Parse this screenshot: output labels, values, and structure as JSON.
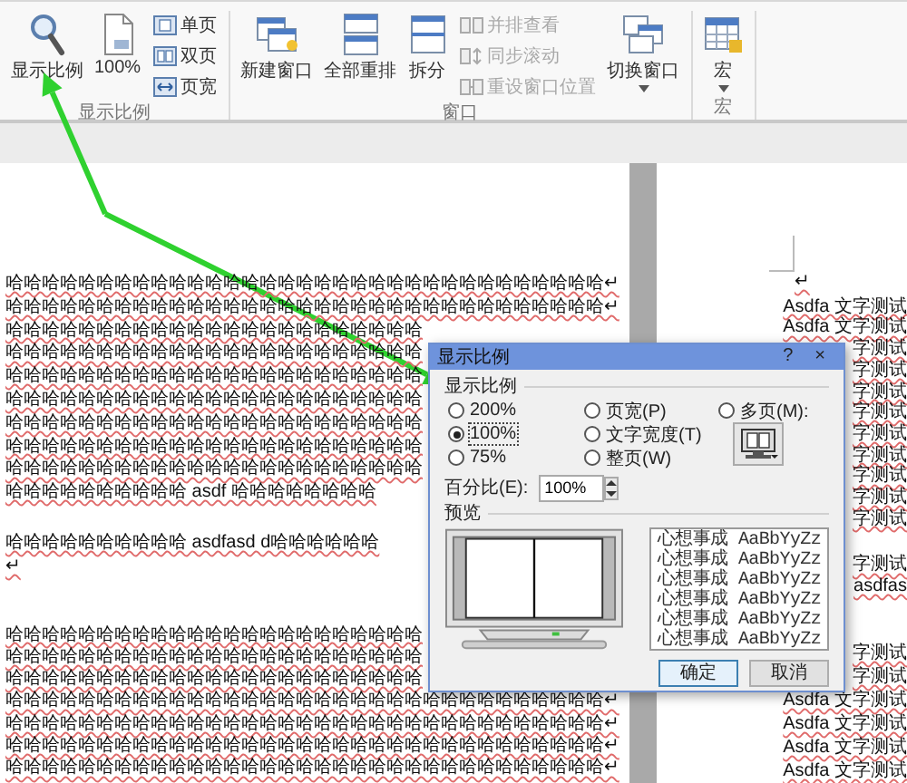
{
  "ribbon": {
    "groups": [
      {
        "label": "显示比例",
        "items": [
          {
            "kind": "large",
            "label": "显示比例",
            "dropdown": false
          },
          {
            "kind": "large",
            "label": "100%",
            "dropdown": false
          },
          {
            "kind": "stack",
            "items": [
              {
                "label": "单页",
                "disabled": false
              },
              {
                "label": "双页",
                "disabled": false
              },
              {
                "label": "页宽",
                "disabled": false
              }
            ]
          }
        ]
      },
      {
        "label": "窗口",
        "items": [
          {
            "kind": "large",
            "label": "新建窗口",
            "dropdown": false
          },
          {
            "kind": "large",
            "label": "全部重排",
            "dropdown": false
          },
          {
            "kind": "large",
            "label": "拆分",
            "dropdown": false
          },
          {
            "kind": "stack",
            "items": [
              {
                "label": "并排查看",
                "disabled": true
              },
              {
                "label": "同步滚动",
                "disabled": true
              },
              {
                "label": "重设窗口位置",
                "disabled": true
              }
            ]
          },
          {
            "kind": "large",
            "label": "切换窗口",
            "dropdown": true
          }
        ]
      },
      {
        "label": "宏",
        "items": [
          {
            "kind": "large",
            "label": "宏",
            "dropdown": true
          }
        ]
      }
    ]
  },
  "document": {
    "left_page": {
      "paragraphs": [
        [
          "哈哈哈哈哈哈哈哈哈哈哈哈哈哈哈哈哈哈哈哈哈哈哈哈哈哈哈哈哈哈哈哈哈↵",
          "哈哈哈哈哈哈哈哈哈哈哈哈哈哈哈哈哈哈哈哈哈哈哈哈哈哈哈哈哈哈哈哈哈↵",
          "哈哈哈哈哈哈哈哈哈哈哈哈哈哈哈哈哈哈哈哈哈哈哈",
          "哈哈哈哈哈哈哈哈哈哈哈哈哈哈哈哈哈哈哈哈哈哈哈",
          "哈哈哈哈哈哈哈哈哈哈哈哈哈哈哈哈哈哈哈哈哈哈哈",
          "哈哈哈哈哈哈哈哈哈哈哈哈哈哈哈哈哈哈哈哈哈哈哈",
          "哈哈哈哈哈哈哈哈哈哈哈哈哈哈哈哈哈哈哈哈哈哈哈",
          "哈哈哈哈哈哈哈哈哈哈哈哈哈哈哈哈哈哈哈哈哈哈哈",
          "哈哈哈哈哈哈哈哈哈哈哈哈哈哈哈哈哈哈哈哈哈哈哈",
          "哈哈哈哈哈哈哈哈哈哈 asdf 哈哈哈哈哈哈哈哈"
        ],
        [
          "哈哈哈哈哈哈哈哈哈哈 asdfasd d哈哈哈哈哈哈",
          "↵"
        ],
        [
          "哈哈哈哈哈哈哈哈哈哈哈哈哈哈哈哈哈哈哈哈哈哈哈",
          "哈哈哈哈哈哈哈哈哈哈哈哈哈哈哈哈哈哈哈哈哈哈哈",
          "哈哈哈哈哈哈哈哈哈哈哈哈哈哈哈哈哈哈哈哈哈哈哈",
          "哈哈哈哈哈哈哈哈哈哈哈哈哈哈哈哈哈哈哈哈哈哈哈哈哈哈哈哈哈哈哈哈哈↵",
          "哈哈哈哈哈哈哈哈哈哈哈哈哈哈哈哈哈哈哈哈哈哈哈哈哈哈哈哈哈哈哈哈哈↵",
          "哈哈哈哈哈哈哈哈哈哈哈哈哈哈哈哈哈哈哈哈哈哈哈哈哈哈哈哈哈哈哈哈哈↵",
          "哈哈哈哈哈哈哈哈哈哈哈哈哈哈哈哈哈哈哈哈哈哈哈哈哈哈哈哈哈哈哈哈哈↵"
        ]
      ]
    },
    "right_page": {
      "paragraphs": [
        [
          "↵"
        ],
        [
          "Asdfa 文字测试",
          "Asdfa 文字测试",
          "字测试",
          "字测试",
          "字测试",
          "字测试",
          "字测试",
          "字测试",
          "字测试",
          "字测试",
          "字测试"
        ],
        [
          "字测试",
          "asdfas"
        ],
        [
          "字测试",
          "字测试",
          "Asdfa 文字测试",
          "Asdfa 文字测试",
          "Asdfa 文字测试",
          "Asdfa 文字测试"
        ]
      ]
    }
  },
  "dialog": {
    "title": "显示比例",
    "help": "?",
    "close": "×",
    "zoom_group": {
      "label": "显示比例",
      "options": [
        {
          "label": "200%",
          "selected": false
        },
        {
          "label": "100%",
          "selected": true
        },
        {
          "label": "75%",
          "selected": false
        },
        {
          "label": "页宽(P)",
          "selected": false
        },
        {
          "label": "文字宽度(T)",
          "selected": false
        },
        {
          "label": "整页(W)",
          "selected": false
        },
        {
          "label": "多页(M):",
          "selected": false
        }
      ],
      "percent": {
        "label": "百分比(E):",
        "value": "100%"
      }
    },
    "preview": {
      "label": "预览",
      "samples": [
        "心想事成 AaBbYyZz",
        "心想事成 AaBbYyZz",
        "心想事成 AaBbYyZz",
        "心想事成 AaBbYyZz",
        "心想事成 AaBbYyZz",
        "心想事成 AaBbYyZz"
      ]
    },
    "buttons": [
      {
        "label": "确定",
        "default": true
      },
      {
        "label": "取消",
        "default": false
      }
    ]
  }
}
